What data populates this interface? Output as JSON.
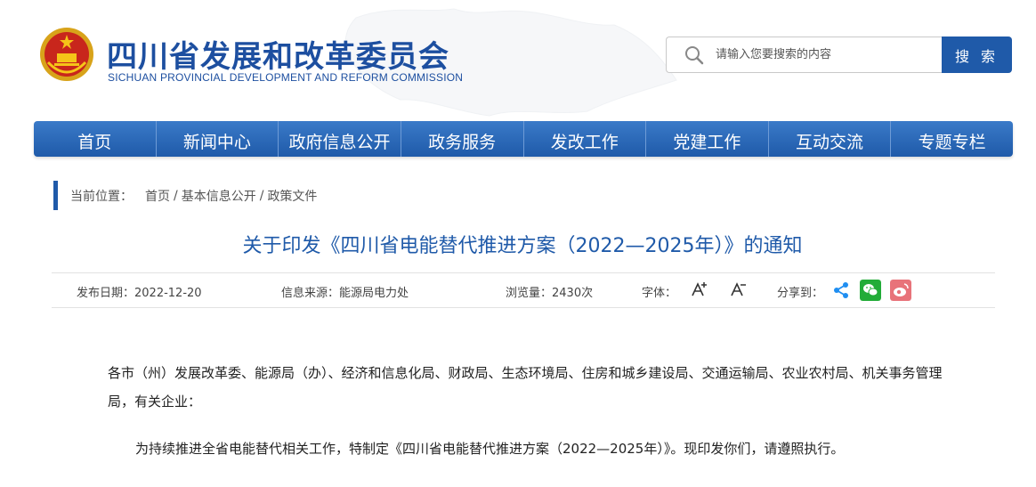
{
  "header": {
    "title": "四川省发展和改革委员会",
    "subtitle": "SICHUAN PROVINCIAL DEVELOPMENT AND REFORM COMMISSION",
    "emblem_icon": "national-emblem-icon"
  },
  "search": {
    "placeholder": "请输入您要搜索的内容",
    "button_label": "搜 索"
  },
  "nav": {
    "items": [
      "首页",
      "新闻中心",
      "政府信息公开",
      "政务服务",
      "发改工作",
      "党建工作",
      "互动交流",
      "专题专栏"
    ]
  },
  "breadcrumb": {
    "label": "当前位置：",
    "items": [
      "首页",
      "基本信息公开",
      "政策文件"
    ],
    "separator": "/"
  },
  "article": {
    "title": "关于印发《四川省电能替代推进方案（2022—2025年）》的通知",
    "meta": {
      "date": "发布日期：2022-12-20",
      "source": "信息来源：能源局电力处",
      "views": "浏览量：2430次",
      "font_label": "字体：",
      "share_label": "分享到："
    },
    "salutation": "各市（州）发展改革委、能源局（办）、经济和信息化局、财政局、生态环境局、住房和城乡建设局、交通运输局、农业农村局、机关事务管理局，有关企业：",
    "paragraph1": "为持续推进全省电能替代相关工作，特制定《四川省电能替代推进方案（2022—2025年）》。现印发你们，请遵照执行。"
  },
  "colors": {
    "brand_blue": "#1f5aa9",
    "wechat_green": "#22ac38",
    "weibo_red": "#e8737a"
  }
}
